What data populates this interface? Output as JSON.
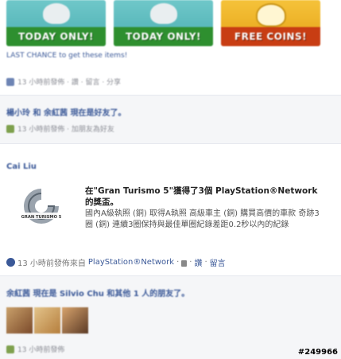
{
  "banners": [
    {
      "label": "TODAY ONLY!"
    },
    {
      "label": "TODAY ONLY!"
    },
    {
      "label": "FREE COINS!"
    }
  ],
  "top_post": {
    "caption": "LAST CHANCE to get these items!",
    "meta": "13 小時前發佈 · 讚 · 留言 · 分享"
  },
  "blurred_activity": {
    "line": "楊小玲 和 余紅茜 現在是好友了。",
    "meta": "13 小時前發佈 · 加朋友為好友"
  },
  "gt_post": {
    "author": "Cai Liu",
    "title": "在\"Gran Turismo 5\"獲得了3個 PlayStation®Network的獎盃。",
    "description": "國內A級執照 (銅) 取得A執照 高級車主 (銅) 購買高價的車款 奇跡3圈 (銅) 連續3圈保持與最佳單圈紀錄差距0.2秒以內的紀錄",
    "footer_time": "13 小時前發佈來自",
    "footer_source": "PlayStation®Network",
    "footer_like": "讚",
    "footer_comment": "留言",
    "logo_text": "GRAN TURISMO 5"
  },
  "bottom_activity": {
    "line": "余紅茜 現在是 Silvio Chu 和其他 1 人的朋友了。",
    "meta": "13 小時前發佈"
  },
  "watermark": "#249966"
}
